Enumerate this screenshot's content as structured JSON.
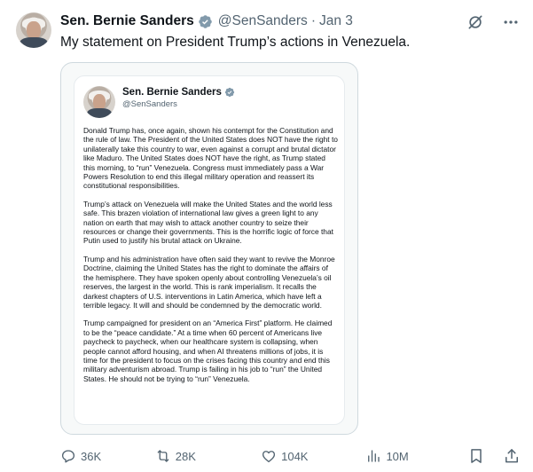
{
  "post": {
    "author_name": "Sen. Bernie Sanders",
    "handle": "@SenSanders",
    "separator": "·",
    "date": "Jan 3",
    "text": "My statement on President Trump’s actions in Venezuela."
  },
  "statement_card": {
    "name": "Sen. Bernie Sanders",
    "handle": "@SenSanders",
    "paragraphs": [
      "Donald Trump has, once again, shown his contempt for the Constitution and the rule of law. The President of the United States does NOT have the right to unilaterally take this country to war, even against a corrupt and brutal dictator like Maduro. The United States does NOT have the right, as Trump stated this morning, to “run” Venezuela. Congress must immediately pass a War Powers Resolution to end this illegal military operation and reassert its constitutional responsibilities.",
      "Trump’s attack on Venezuela will make the United States and the world less safe. This brazen violation of international law gives a green light to any nation on earth that may wish to attack another country to seize their resources or change their governments. This is the horrific logic of force that Putin used to justify his brutal attack on Ukraine.",
      "Trump and his administration have often said they want to revive the Monroe Doctrine, claiming the United States has the right to dominate the affairs of the hemisphere. They have spoken openly about controlling Venezuela’s oil reserves, the largest in the world. This is rank imperialism. It recalls the darkest chapters of U.S. interventions in Latin America, which have left a terrible legacy. It will and should be condemned by the democratic world.",
      "Trump campaigned for president on an “America First” platform. He claimed to be the “peace candidate.” At a time when 60 percent of Americans live paycheck to paycheck, when our healthcare system is collapsing, when people cannot afford housing, and when AI threatens millions of jobs, it is time for the president to focus on the crises facing this country and end this military adventurism abroad. Trump is failing in his job to “run” the United States.  He should not be trying to “run” Venezuela."
    ]
  },
  "actions": {
    "replies": "36K",
    "reposts": "28K",
    "likes": "104K",
    "views": "10M"
  },
  "colors": {
    "text": "#0f1419",
    "secondary": "#536471",
    "verified_badge": "#829aab",
    "border": "#cfd9de"
  },
  "icons": [
    "grok-icon",
    "more-icon",
    "reply-icon",
    "repost-icon",
    "like-icon",
    "views-icon",
    "bookmark-icon",
    "share-icon",
    "verified-icon"
  ]
}
